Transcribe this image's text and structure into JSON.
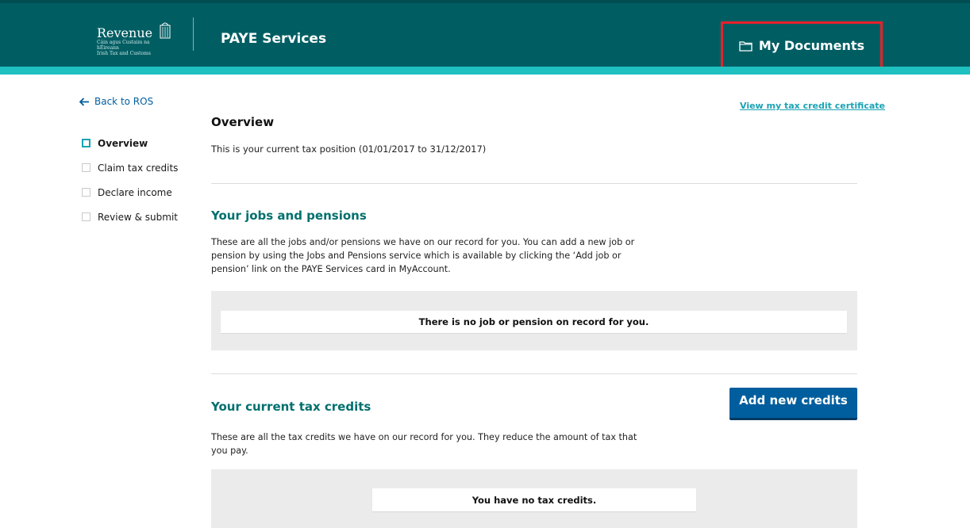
{
  "header": {
    "logo": {
      "name": "Revenue",
      "subtitle": "Cáin agus Custaim na hÉireann\nIrish Tax and Customs"
    },
    "service_title": "PAYE Services",
    "my_documents_label": "My Documents",
    "colors": {
      "header_bg": "#005e63",
      "accent_strip": "#1ec0c0",
      "highlight_box": "#e8202a"
    }
  },
  "sidebar": {
    "back_label": "Back to ROS",
    "items": [
      {
        "label": "Overview",
        "active": true
      },
      {
        "label": "Claim tax credits",
        "active": false
      },
      {
        "label": "Declare income",
        "active": false
      },
      {
        "label": "Review & submit",
        "active": false
      }
    ]
  },
  "main": {
    "certificate_link": "View my tax credit certificate",
    "title": "Overview",
    "intro": "This is your current tax position (01/01/2017 to 31/12/2017)",
    "jobs": {
      "title": "Your jobs and pensions",
      "description": "These are all the jobs and/or pensions we have on our record for you. You can add a new job or pension by using the Jobs and Pensions service which is available by clicking the ‘Add job or pension’ link on the PAYE Services card in MyAccount.",
      "empty_message": "There is no job or pension on record for you."
    },
    "credits": {
      "title": "Your current tax credits",
      "add_button": "Add new credits",
      "description": "These are all the tax credits we have on our record for you. They reduce the amount of tax that you pay.",
      "empty_message": "You have no tax credits."
    }
  },
  "icons": [
    "revenue-harp-icon",
    "folder-icon",
    "arrow-left-icon"
  ]
}
